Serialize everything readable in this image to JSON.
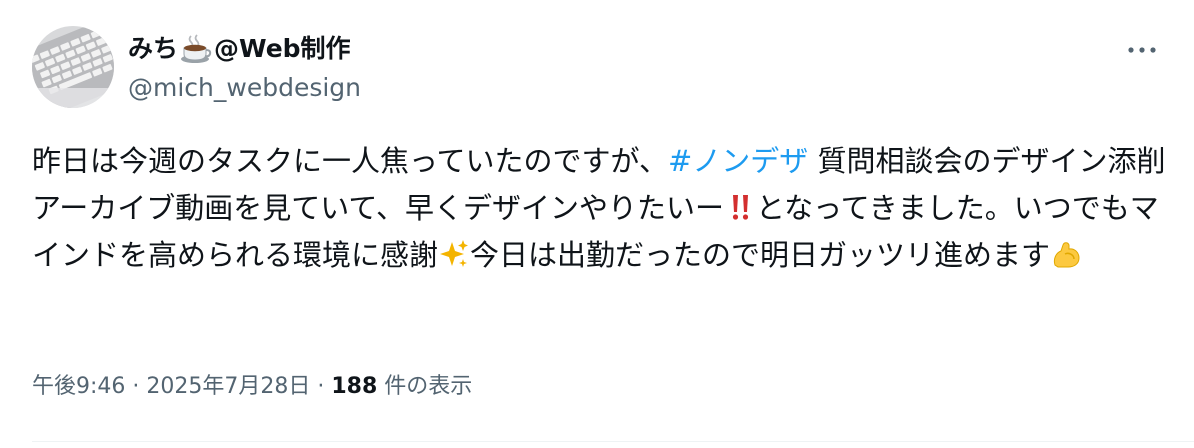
{
  "author": {
    "display_name_prefix": "みち",
    "display_name_suffix": "@Web制作",
    "handle": "@mich_webdesign",
    "avatar_icon": "laptop-keyboard-photo"
  },
  "tweet": {
    "text_1": "昨日は今週のタスクに一人焦っていたのですが、",
    "hashtag": "#ノンデザ",
    "text_2": " 質問相談会のデザイン添削アーカイブ動画を見ていて、早くデザインやりたいー",
    "text_3": "となってきました。いつでもマインドを高められる環境に感謝",
    "text_4": "今日は出勤だったので明日ガッツリ進めます",
    "emoji_icons": [
      "double-exclamation-icon",
      "sparkles-icon",
      "flexed-biceps-icon"
    ]
  },
  "meta": {
    "time": "午後9:46",
    "separator": " · ",
    "date": "2025年7月28日",
    "views_count": "188",
    "views_label": " 件の表示"
  },
  "colors": {
    "text": "#0f1419",
    "secondary": "#536471",
    "hashtag": "#1d9bf0",
    "divider": "#eff3f4"
  }
}
